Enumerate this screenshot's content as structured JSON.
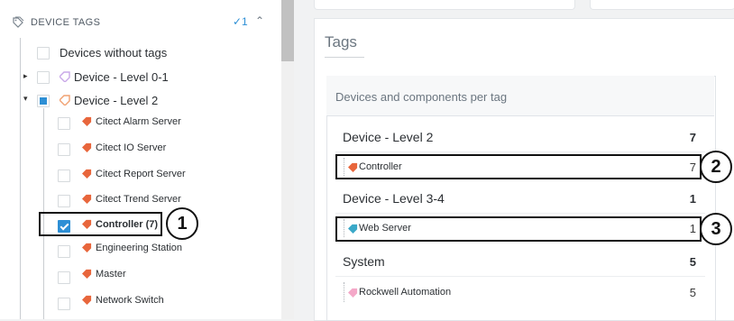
{
  "sidebar": {
    "title": "DEVICE TAGS",
    "selected_count": "✓1",
    "collapse_icon": "chevron-up-icon",
    "items": [
      {
        "label": "Devices without tags",
        "checkbox": "unchecked",
        "tag_color": null
      },
      {
        "label": "Device - Level 0-1",
        "checkbox": "unchecked",
        "expandable": "collapsed",
        "tag_color": "#c9a8e8"
      },
      {
        "label": "Device - Level 2",
        "checkbox": "partial",
        "expandable": "expanded",
        "tag_color": "#f0a070"
      },
      {
        "label": "Citect Alarm Server",
        "checkbox": "unchecked",
        "tag_color": "#e8663c"
      },
      {
        "label": "Citect IO Server",
        "checkbox": "unchecked",
        "tag_color": "#e8663c"
      },
      {
        "label": "Citect Report Server",
        "checkbox": "unchecked",
        "tag_color": "#e8663c"
      },
      {
        "label": "Citect Trend Server",
        "checkbox": "unchecked",
        "tag_color": "#e8663c"
      },
      {
        "label": "Controller (7)",
        "checkbox": "checked",
        "tag_color": "#e8663c"
      },
      {
        "label": "Engineering Station",
        "checkbox": "unchecked",
        "tag_color": "#e8663c"
      },
      {
        "label": "Master",
        "checkbox": "unchecked",
        "tag_color": "#e8663c"
      },
      {
        "label": "Network Switch",
        "checkbox": "unchecked",
        "tag_color": "#e8663c"
      }
    ]
  },
  "callouts": [
    "1",
    "2",
    "3"
  ],
  "main": {
    "tags_title": "Tags",
    "panel_header": "Devices and components per tag",
    "groups": [
      {
        "name": "Device - Level 2",
        "count": "7",
        "items": [
          {
            "label": "Controller",
            "count": "7",
            "tag_color": "#e8663c"
          }
        ]
      },
      {
        "name": "Device - Level 3-4",
        "count": "1",
        "items": [
          {
            "label": "Web Server",
            "count": "1",
            "tag_color": "#3aa8c8"
          }
        ]
      },
      {
        "name": "System",
        "count": "5",
        "items": [
          {
            "label": "Rockwell Automation",
            "count": "5",
            "tag_color": "#f4a8c8"
          }
        ]
      }
    ]
  },
  "colors": {
    "accent": "#2d8fd5",
    "highlight_border": "#111111"
  }
}
